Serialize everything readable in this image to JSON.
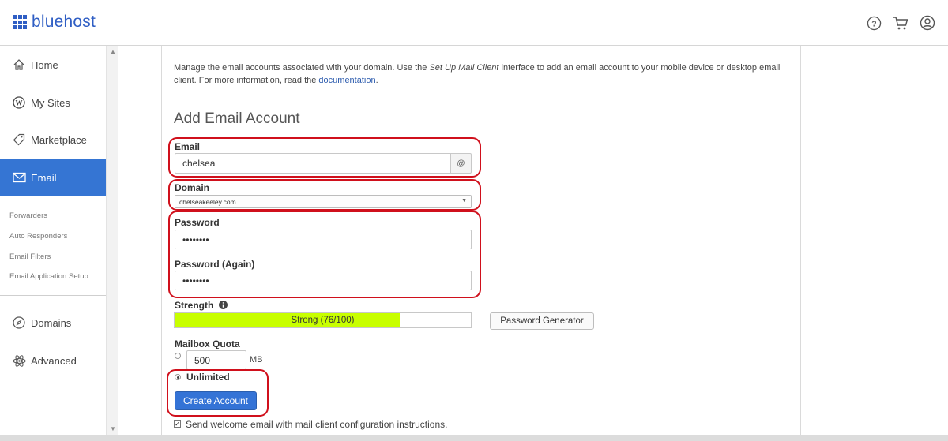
{
  "header": {
    "brand": "bluehost",
    "icons": [
      "help-icon",
      "cart-icon",
      "user-account-icon"
    ]
  },
  "sidebar": {
    "items": [
      {
        "label": "Home",
        "icon": "home-icon"
      },
      {
        "label": "My Sites",
        "icon": "wordpress-icon"
      },
      {
        "label": "Marketplace",
        "icon": "tag-icon"
      },
      {
        "label": "Email",
        "icon": "envelope-icon",
        "active": true
      },
      {
        "label": "Domains",
        "icon": "compass-icon"
      },
      {
        "label": "Advanced",
        "icon": "atom-icon"
      }
    ],
    "sub_items": [
      "Forwarders",
      "Auto Responders",
      "Email Filters",
      "Email Application Setup"
    ]
  },
  "main": {
    "intro_part1": "Manage the email accounts associated with your domain. Use the ",
    "intro_em": "Set Up Mail Client",
    "intro_part2": " interface to add an email account to your mobile device or desktop email client. For more information, read the ",
    "intro_link": "documentation",
    "intro_end": ".",
    "title": "Add Email Account",
    "email_label": "Email",
    "email_value": "chelsea",
    "email_addon": "@",
    "domain_label": "Domain",
    "domain_value": "chelseakeeley.com",
    "password_label": "Password",
    "password_value": "••••••••",
    "password_again_label": "Password (Again)",
    "password_again_value": "••••••••",
    "strength_label": "Strength",
    "strength_text": "Strong (76/100)",
    "strength_score": 76,
    "password_generator_label": "Password Generator",
    "quota_label": "Mailbox Quota",
    "quota_value": "500",
    "quota_unit": "MB",
    "unlimited_label": "Unlimited",
    "create_button": "Create Account",
    "welcome_checkbox_label": "Send welcome email with mail client configuration instructions."
  },
  "colors": {
    "brand": "#2f5ec4",
    "active_nav": "#3575d3",
    "highlight": "#d0101c",
    "strength_fill": "#c8ff00",
    "primary_button": "#3473d6"
  }
}
